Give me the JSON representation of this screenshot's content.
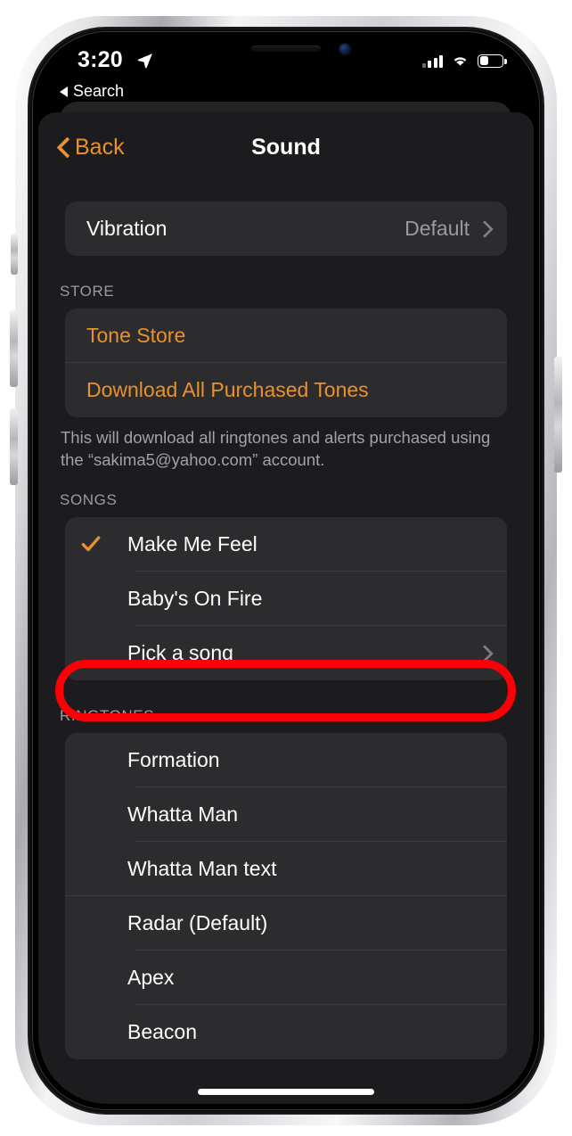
{
  "status_bar": {
    "time": "3:20",
    "location_icon": "location-arrow-icon",
    "signal_icon": "cellular-signal-icon",
    "wifi_icon": "wifi-icon",
    "battery_icon": "battery-icon",
    "battery_level_percent": 33
  },
  "back_to_app": {
    "label": "Search",
    "icon": "back-triangle-icon"
  },
  "nav": {
    "back_label": "Back",
    "title": "Sound",
    "back_icon": "chevron-left-icon"
  },
  "vibration": {
    "label": "Vibration",
    "value": "Default",
    "chevron_icon": "chevron-right-icon"
  },
  "store": {
    "header": "STORE",
    "items": [
      {
        "label": "Tone Store"
      },
      {
        "label": "Download All Purchased Tones"
      }
    ],
    "footer": "This will download all ringtones and alerts purchased using the “sakima5@yahoo.com” account."
  },
  "songs": {
    "header": "SONGS",
    "items": [
      {
        "label": "Make Me Feel",
        "selected": true,
        "chevron": false
      },
      {
        "label": "Baby's On Fire",
        "selected": false,
        "chevron": false
      },
      {
        "label": "Pick a song",
        "selected": false,
        "chevron": true,
        "highlighted": true
      }
    ]
  },
  "ringtones": {
    "header": "RINGTONES",
    "items": [
      {
        "label": "Formation"
      },
      {
        "label": "Whatta Man"
      },
      {
        "label": "Whatta Man text"
      },
      {
        "label": "Radar (Default)"
      },
      {
        "label": "Apex"
      },
      {
        "label": "Beacon"
      }
    ]
  },
  "colors": {
    "accent": "#e8912d",
    "annotation": "#fb0007",
    "card": "#2c2c2e",
    "background": "#1c1c1e",
    "secondary_text": "#9a9a9f"
  }
}
